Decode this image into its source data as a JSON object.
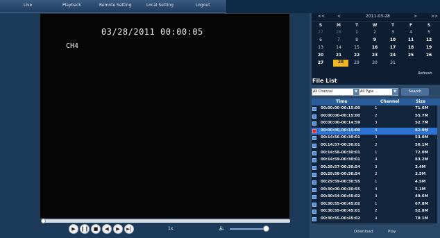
{
  "nav": {
    "live": "Live",
    "playback": "Playback",
    "remote": "Remote Setting",
    "local": "Local Setting",
    "logout": "Logout"
  },
  "video": {
    "timestamp": "03/28/2011 00:00:05",
    "channel": "CH4"
  },
  "controls": {
    "speed": "1x",
    "playback_position": 0.0,
    "volume": 1.0
  },
  "calendar": {
    "prev_year": "<<",
    "prev_month": "<",
    "title": "2011-03-28",
    "next_month": ">",
    "next_year": ">>",
    "weekdays": [
      "S",
      "M",
      "T",
      "W",
      "T",
      "F",
      "S"
    ],
    "weeks": [
      [
        "27",
        "28",
        "1",
        "2",
        "3",
        "4",
        "5"
      ],
      [
        "6",
        "7",
        "8",
        "9",
        "10",
        "11",
        "12"
      ],
      [
        "13",
        "14",
        "15",
        "16",
        "17",
        "18",
        "19"
      ],
      [
        "20",
        "21",
        "22",
        "23",
        "24",
        "25",
        "26"
      ],
      [
        "27",
        "28",
        "29",
        "30",
        "31",
        "",
        ""
      ]
    ],
    "refresh": "Refresh"
  },
  "file_list": {
    "title": "File List",
    "channel_filter": "All Channel",
    "type_filter": "All Type",
    "search": "Search",
    "headers": {
      "time": "Time",
      "channel": "Channel",
      "size": "Size"
    },
    "rows": [
      {
        "time": "00:00:00-00:15:00",
        "channel": "1",
        "size": "71.6M"
      },
      {
        "time": "00:00:00-00:15:00",
        "channel": "2",
        "size": "55.7M"
      },
      {
        "time": "00:00:00-00:14:59",
        "channel": "3",
        "size": "52.7M"
      },
      {
        "time": "00:00:00-00:15:00",
        "channel": "4",
        "size": "82.9M"
      },
      {
        "time": "00:14:56-00:30:01",
        "channel": "3",
        "size": "53.0M"
      },
      {
        "time": "00:14:57-00:30:01",
        "channel": "2",
        "size": "56.1M"
      },
      {
        "time": "00:14:58-00:30:01",
        "channel": "1",
        "size": "72.0M"
      },
      {
        "time": "00:14:59-00:30:01",
        "channel": "4",
        "size": "83.2M"
      },
      {
        "time": "00:29:57-00:30:54",
        "channel": "3",
        "size": "3.4M"
      },
      {
        "time": "00:29:58-00:30:54",
        "channel": "2",
        "size": "3.5M"
      },
      {
        "time": "00:29:59-00:30:55",
        "channel": "1",
        "size": "4.5M"
      },
      {
        "time": "00:30:00-00:30:55",
        "channel": "4",
        "size": "5.1M"
      },
      {
        "time": "00:30:54-00:45:02",
        "channel": "3",
        "size": "49.6M"
      },
      {
        "time": "00:30:55-00:45:02",
        "channel": "1",
        "size": "67.8M"
      },
      {
        "time": "00:30:55-00:45:01",
        "channel": "2",
        "size": "52.8M"
      },
      {
        "time": "00:30:55-00:45:02",
        "channel": "4",
        "size": "78.1M"
      }
    ],
    "download": "Download",
    "play": "Play"
  }
}
